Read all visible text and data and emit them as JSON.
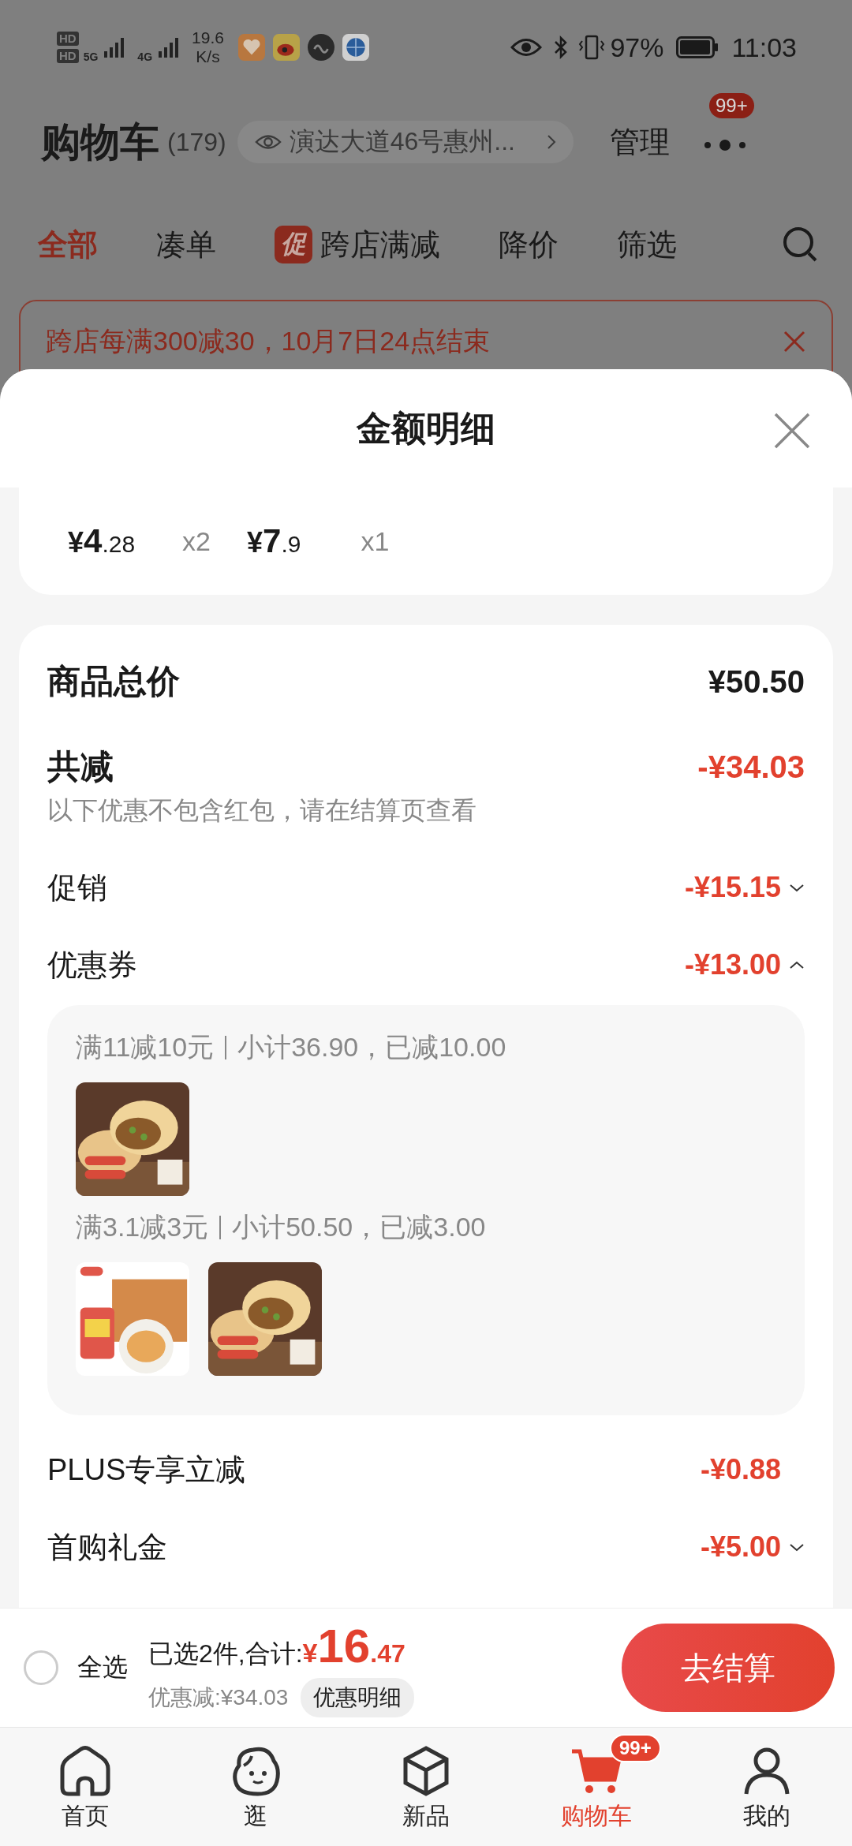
{
  "status_bar": {
    "sim_labels": [
      "HD",
      "HD"
    ],
    "networks": [
      "5G",
      "4G"
    ],
    "speed": "19.6",
    "speed_unit": "K/s",
    "battery": "97%",
    "time": "11:03"
  },
  "header": {
    "title": "购物车",
    "count": "(179)",
    "address": "演达大道46号惠州...",
    "manage": "管理",
    "badge": "99+"
  },
  "tabs": [
    {
      "label": "全部",
      "selected": true
    },
    {
      "label": "凑单",
      "selected": false
    },
    {
      "label": "跨店满减",
      "selected": false,
      "tag": "促"
    },
    {
      "label": "降价",
      "selected": false
    },
    {
      "label": "筛选",
      "selected": false
    }
  ],
  "banner": {
    "text": "跨店每满300减30，10月7日24点结束"
  },
  "sheet": {
    "title": "金额明细",
    "price_items": [
      {
        "symbol": "¥",
        "integer": "4",
        "decimal": ".28",
        "qty": "x2"
      },
      {
        "symbol": "¥",
        "integer": "7",
        "decimal": ".9",
        "qty": "x1"
      }
    ],
    "total": {
      "label": "商品总价",
      "amount": "¥50.50"
    },
    "discount": {
      "label": "共减",
      "amount": "-¥34.03",
      "note": "以下优惠不包含红包，请在结算页查看"
    },
    "rows": [
      {
        "label": "促销",
        "amount": "-¥15.15",
        "expanded": false
      },
      {
        "label": "优惠券",
        "amount": "-¥13.00",
        "expanded": true,
        "groups": [
          {
            "rule": "满11减10元",
            "detail": "小计36.90，已减10.00"
          },
          {
            "rule": "满3.1减3元",
            "detail": "小计50.50，已减3.00"
          }
        ]
      },
      {
        "label": "PLUS专享立减",
        "amount": "-¥0.88"
      },
      {
        "label": "首购礼金",
        "amount": "-¥5.00",
        "expanded": false
      }
    ]
  },
  "bottom_bar": {
    "select_all": {
      "label": "全选",
      "checked": false
    },
    "selected_text": "已选2件,合计:",
    "symbol": "¥",
    "integer": "16",
    "decimal": ".47",
    "saved": "优惠减:¥34.03",
    "detail_button": "优惠明细",
    "checkout": "去结算"
  },
  "nav": [
    {
      "label": "首页",
      "selected": false
    },
    {
      "label": "逛",
      "selected": false
    },
    {
      "label": "新品",
      "selected": false
    },
    {
      "label": "购物车",
      "selected": true,
      "badge": "99+"
    },
    {
      "label": "我的",
      "selected": false
    }
  ]
}
